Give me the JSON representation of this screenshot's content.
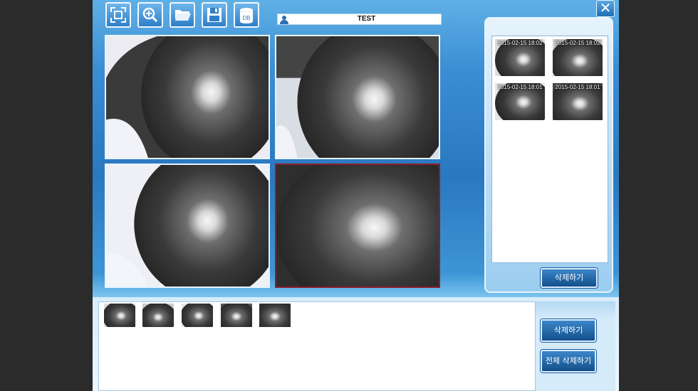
{
  "toolbar": {
    "tools": [
      {
        "icon": "fullscreen-icon"
      },
      {
        "icon": "zoom-in-icon"
      },
      {
        "icon": "folder-open-icon"
      },
      {
        "icon": "save-icon"
      },
      {
        "icon": "database-icon",
        "label": "DB"
      }
    ],
    "close_icon": "close-icon"
  },
  "patient": {
    "name": "TEST",
    "icon": "user-icon"
  },
  "viewers": {
    "count": 4,
    "selected_index": 3
  },
  "history": {
    "items": [
      {
        "timestamp": "2015-02-15 18:02"
      },
      {
        "timestamp": "2015-02-15 18:02"
      },
      {
        "timestamp": "2015-02-15 18:01"
      },
      {
        "timestamp": "2015-02-15 18:01"
      }
    ],
    "delete_label": "삭제하기"
  },
  "tray": {
    "thumb_count": 5,
    "delete_label": "삭제하기",
    "delete_all_label": "전체 삭제하기"
  },
  "colors": {
    "accent": "#2a78c0",
    "selected_border": "#8a1e2c"
  }
}
